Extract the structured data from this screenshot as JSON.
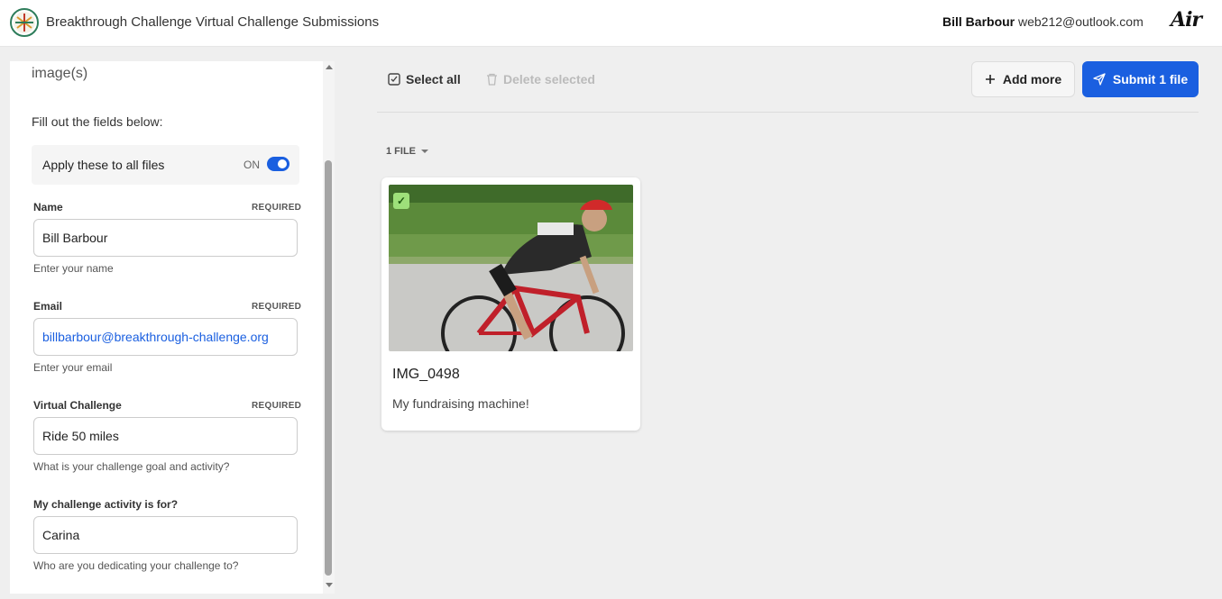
{
  "header": {
    "title": "Breakthrough Challenge Virtual Challenge Submissions",
    "user_name": "Bill Barbour",
    "user_email": "web212@outlook.com",
    "brand": "Air"
  },
  "form": {
    "heading": "image(s)",
    "instructions": "Fill out the fields below:",
    "apply_all_label": "Apply these to all files",
    "apply_all_state": "ON",
    "fields": [
      {
        "label": "Name",
        "required": "REQUIRED",
        "value": "Bill Barbour",
        "hint": "Enter your name"
      },
      {
        "label": "Email",
        "required": "REQUIRED",
        "value": "billbarbour@breakthrough-challenge.org",
        "hint": "Enter your email"
      },
      {
        "label": "Virtual Challenge",
        "required": "REQUIRED",
        "value": "Ride 50 miles",
        "hint": "What is your challenge goal and activity?"
      },
      {
        "label": "My challenge activity is for?",
        "value": "Carina",
        "hint": "Who are you dedicating your challenge to?"
      }
    ]
  },
  "toolbar": {
    "select_all": "Select all",
    "delete_selected": "Delete selected",
    "add_more": "Add more",
    "submit": "Submit 1 file"
  },
  "files": {
    "count_label": "1 FILE",
    "items": [
      {
        "title": "IMG_0498",
        "description": "My fundraising machine!",
        "selected": true
      }
    ]
  },
  "colors": {
    "accent": "#1a5fe0",
    "check": "#9ee07a"
  }
}
